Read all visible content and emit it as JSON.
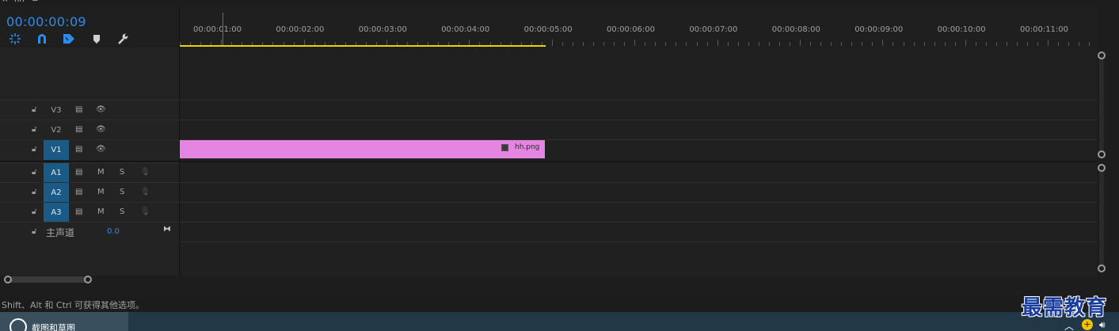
{
  "tab": {
    "close": "×",
    "name": "hh",
    "menu": "≡"
  },
  "timecode": "00:00:00:09",
  "tools": [
    "snap-icon",
    "linked-selection-icon",
    "add-marker-icon",
    "marker-icon",
    "wrench-icon"
  ],
  "ruler": {
    "labels": [
      "00:00:01:00",
      "00:00:02:00",
      "00:00:03:00",
      "00:00:04:00",
      "00:00:05:00",
      "00:00:06:00",
      "00:00:07:00",
      "00:00:08:00",
      "00:00:09:00",
      "00:00:10:00",
      "00:00:11:00"
    ]
  },
  "tracks": {
    "video": [
      {
        "label": "V3",
        "active": false
      },
      {
        "label": "V2",
        "active": false
      },
      {
        "label": "V1",
        "active": true
      }
    ],
    "audio": [
      {
        "label": "A1",
        "mute": "M",
        "solo": "S"
      },
      {
        "label": "A2",
        "mute": "M",
        "solo": "S"
      },
      {
        "label": "A3",
        "mute": "M",
        "solo": "S"
      }
    ],
    "master": {
      "label": "主声道",
      "value": "0.0"
    }
  },
  "clip": {
    "name": "hh.png",
    "color": "#e485e2"
  },
  "status_text": "Shift、Alt 和 Ctrl 可获得其他选项。",
  "taskbar": {
    "app_label": "截图和草图"
  },
  "watermark": "最需教育",
  "colors": {
    "accent": "#2d8ceb",
    "work_area": "#e8d200",
    "active_track": "#1c5a86"
  }
}
